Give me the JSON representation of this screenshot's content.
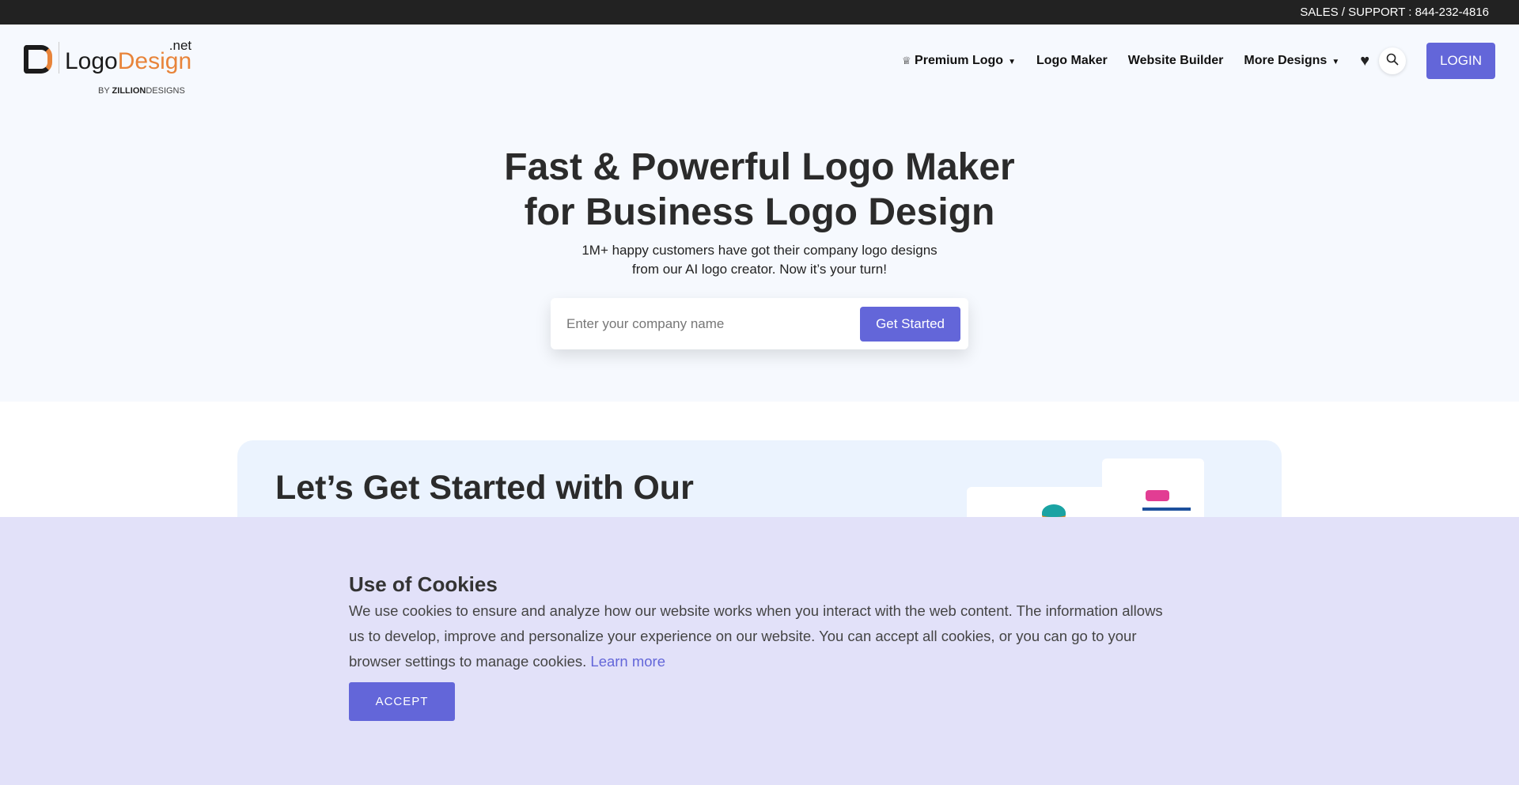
{
  "topbar": {
    "support": "SALES / SUPPORT : 844-232-4816"
  },
  "logo": {
    "text_a": "Logo",
    "text_b": "Design",
    "tld": ".net",
    "by": "BY",
    "company": "ZILLION",
    "company2": "DESIGNS"
  },
  "nav": {
    "items": [
      {
        "label": "Premium Logo",
        "icon": "crown-icon",
        "dropdown": true
      },
      {
        "label": "Logo Maker"
      },
      {
        "label": "Website Builder"
      },
      {
        "label": "More Designs",
        "dropdown": true
      }
    ],
    "login": "LOGIN",
    "caret": "▼",
    "heart": "♥",
    "search": "⌕"
  },
  "hero": {
    "title_line1": "Fast & Powerful Logo Maker",
    "title_line2": "for Business Logo Design",
    "subtitle_line1": "1M+ happy customers have got their company logo designs",
    "subtitle_line2": "from our AI logo creator. Now it’s your turn!",
    "input_placeholder": "Enter your company name",
    "button": "Get Started"
  },
  "section": {
    "title": "Let’s Get Started with Our"
  },
  "cookie": {
    "title": "Use of Cookies",
    "text": "We use cookies to ensure and analyze how our website works when you interact with the web content. The information allows us to develop, improve and personalize your experience on our website. You can accept all cookies, or you can go to your browser settings to manage cookies. ",
    "link": "Learn more",
    "accept": "ACCEPT"
  },
  "colors": {
    "accent": "#6366d9",
    "brand_orange": "#e8843a",
    "cookie_bg": "#e2e1f9",
    "topbar": "#222222"
  }
}
